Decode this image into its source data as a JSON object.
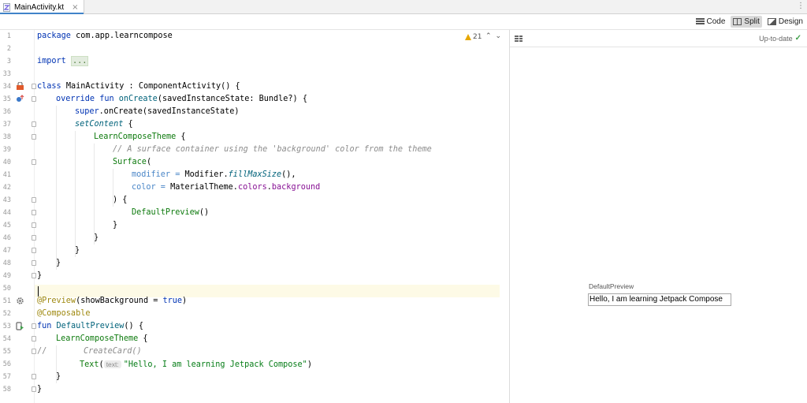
{
  "tab": {
    "label": "MainActivity.kt",
    "close": "×",
    "menu": "⋮"
  },
  "modes": [
    {
      "label": "Code",
      "icon": "code-lines-icon",
      "active": false
    },
    {
      "label": "Split",
      "icon": "split-view-icon",
      "active": true
    },
    {
      "label": "Design",
      "icon": "design-image-icon",
      "active": false
    }
  ],
  "editor": {
    "warnings": "21",
    "line_numbers": [
      "1",
      "2",
      "3",
      "33",
      "34",
      "35",
      "36",
      "37",
      "38",
      "39",
      "40",
      "41",
      "42",
      "43",
      "44",
      "45",
      "46",
      "47",
      "48",
      "49",
      "50",
      "51",
      "52",
      "53",
      "54",
      "55",
      "56",
      "57",
      "58"
    ],
    "code": {
      "l1_kw": "package ",
      "l1_pkg": "com.app.learncompose",
      "l3_kw": "import ",
      "l3_fold": "...",
      "l34_kw": "class ",
      "l34_name": "MainActivity",
      "l34_rest": " : ComponentActivity() {",
      "l35_kw": "override fun ",
      "l35_fn": "onCreate",
      "l35_rest": "(savedInstanceState: Bundle?) {",
      "l36_kw": "super",
      "l36_rest": ".onCreate(savedInstanceState)",
      "l37_fn": "setContent",
      "l37_rest": " {",
      "l38_cmp": "LearnComposeTheme",
      "l38_rest": " {",
      "l39_com": "// A surface container using the 'background' color from the theme",
      "l40_cmp": "Surface",
      "l40_rest": "(",
      "l41_prm": "modifier = ",
      "l41_mid": "Modifier.",
      "l41_it": "fillMaxSize",
      "l41_rest": "(),",
      "l42_prm": "color = ",
      "l42_mid": "MaterialTheme.",
      "l42_nm": "colors",
      "l42_dot": ".",
      "l42_nm2": "background",
      "l43_text": ") {",
      "l44_cmp": "DefaultPreview",
      "l44_rest": "()",
      "l45_text": "}",
      "l46_text": "}",
      "l47_text": "}",
      "l48_text": "}",
      "l49_text": "}",
      "l51_ann": "@Preview",
      "l51_rest": "(showBackground = ",
      "l51_kw": "true",
      "l51_end": ")",
      "l52_ann": "@Composable",
      "l53_kw": "fun ",
      "l53_fn": "DefaultPreview",
      "l53_rest": "() {",
      "l54_cmp": "LearnComposeTheme",
      "l54_rest": " {",
      "l55_com1": "//",
      "l55_com2": "CreateCard()",
      "l56_cmp": "Text",
      "l56_paren": "(",
      "l56_hint": "text:",
      "l56_str": "\"Hello, I am learning Jetpack Compose\"",
      "l56_end": ")",
      "l57_text": "}",
      "l58_text": "}"
    }
  },
  "preview": {
    "status": "Up-to-date",
    "name": "DefaultPreview",
    "text": "Hello, I am learning Jetpack Compose"
  },
  "colors": {
    "keyword": "#0033b3",
    "string": "#067d17",
    "comment": "#8c8c8c",
    "annotation": "#9e880d",
    "composable": "#0d7a0d",
    "current_line": "#fdfae6",
    "tab_accent": "#4083c9"
  }
}
